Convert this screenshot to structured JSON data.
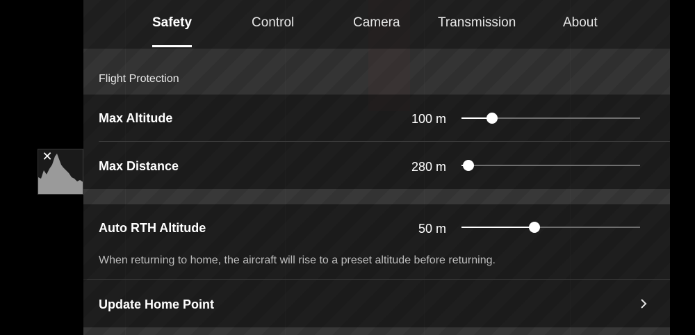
{
  "tabs": [
    {
      "label": "Safety",
      "active": true
    },
    {
      "label": "Control",
      "active": false
    },
    {
      "label": "Camera",
      "active": false
    },
    {
      "label": "Transmission",
      "active": false
    },
    {
      "label": "About",
      "active": false
    }
  ],
  "section": {
    "title": "Flight Protection"
  },
  "settings": {
    "max_altitude": {
      "label": "Max Altitude",
      "value": "100 m",
      "slider_fraction": 0.17
    },
    "max_distance": {
      "label": "Max Distance",
      "value": "280 m",
      "slider_fraction": 0.04
    },
    "rth_altitude": {
      "label": "Auto RTH Altitude",
      "value": "50 m",
      "slider_fraction": 0.41,
      "hint": "When returning to home, the aircraft will rise to a preset altitude before returning."
    },
    "update_home": {
      "label": "Update Home Point",
      "icon": "chevron-right-icon"
    }
  },
  "histogram": {
    "close_icon": "close-icon"
  },
  "colors": {
    "accent": "#ffffff",
    "track": "#6e6e6e",
    "panel": "#181818"
  }
}
